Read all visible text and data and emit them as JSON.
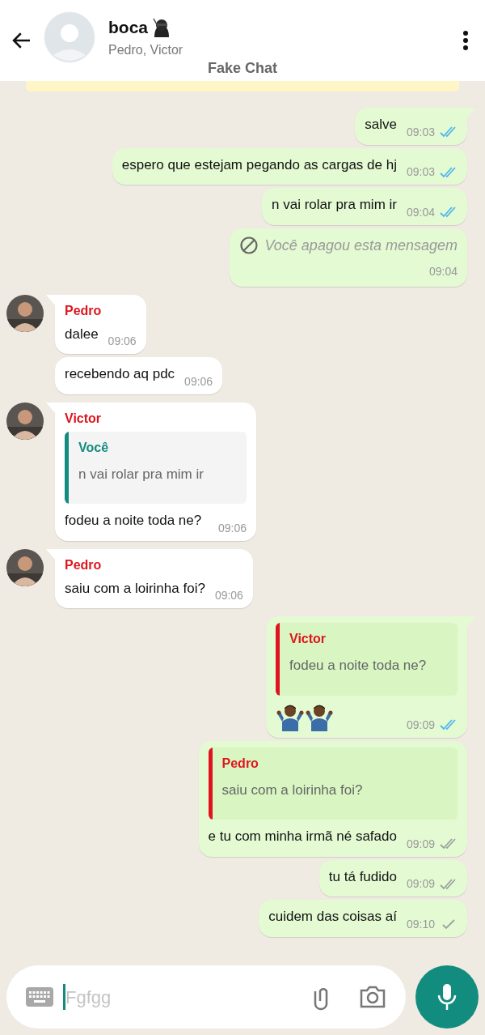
{
  "header": {
    "title": "boca",
    "subtitle": "Pedro, Victor"
  },
  "app_label": "Fake Chat",
  "messages": [
    {
      "kind": "outgoing",
      "tail": true,
      "text": "salve",
      "time": "09:03",
      "sent": true,
      "delivered": true,
      "read": true
    },
    {
      "kind": "outgoing",
      "tail": false,
      "text": "espero que estejam pegando as cargas de hj",
      "time": "09:03",
      "sent": true,
      "delivered": true,
      "read": true
    },
    {
      "kind": "outgoing",
      "tail": false,
      "text": "n vai rolar pra mim ir",
      "time": "09:04",
      "sent": true,
      "delivered": true,
      "read": true
    },
    {
      "kind": "outgoing",
      "tail": false,
      "deleted": true,
      "sent": false,
      "text": "Você apagou esta mensagem",
      "time": "09:04"
    },
    {
      "kind": "incoming",
      "tail": true,
      "avatar": true,
      "sender": "Pedro",
      "text": "dalee",
      "time": "09:06"
    },
    {
      "kind": "incoming",
      "tail": false,
      "avatar": false,
      "text": "recebendo aq pdc",
      "time": "09:06"
    },
    {
      "kind": "incoming",
      "tail": true,
      "avatar": true,
      "sender": "Victor",
      "quote": {
        "author": "Você",
        "color": "#128c7e",
        "text": "n vai rolar pra mim ir"
      },
      "text": "fodeu a noite toda ne?",
      "time": "09:06"
    },
    {
      "kind": "incoming",
      "tail": true,
      "avatar": true,
      "sender": "Pedro",
      "text": "saiu com a loirinha foi?",
      "time": "09:06"
    },
    {
      "kind": "outgoing",
      "tail": true,
      "quote": {
        "author": "Victor",
        "color": "#e0141e",
        "text": "fodeu a noite toda ne?"
      },
      "stickers": [
        {
          "kind": "shrug"
        },
        {
          "kind": "shrug"
        }
      ],
      "time": "09:09",
      "sent": true,
      "delivered": true,
      "read": true
    },
    {
      "kind": "outgoing",
      "tail": false,
      "quote": {
        "author": "Pedro",
        "color": "#e0141e",
        "text": "saiu com a loirinha foi?"
      },
      "text": "e tu com minha irmã né safado",
      "time": "09:09",
      "sent": true,
      "delivered": true,
      "read": false
    },
    {
      "kind": "outgoing",
      "tail": false,
      "text": "tu tá fudido",
      "time": "09:09",
      "sent": true,
      "delivered": true,
      "read": false
    },
    {
      "kind": "outgoing",
      "tail": false,
      "text": "cuidem das coisas aí",
      "time": "09:10",
      "sent": true,
      "delivered": false,
      "read": false
    }
  ],
  "composer": {
    "placeholder": "Fgfgg"
  }
}
